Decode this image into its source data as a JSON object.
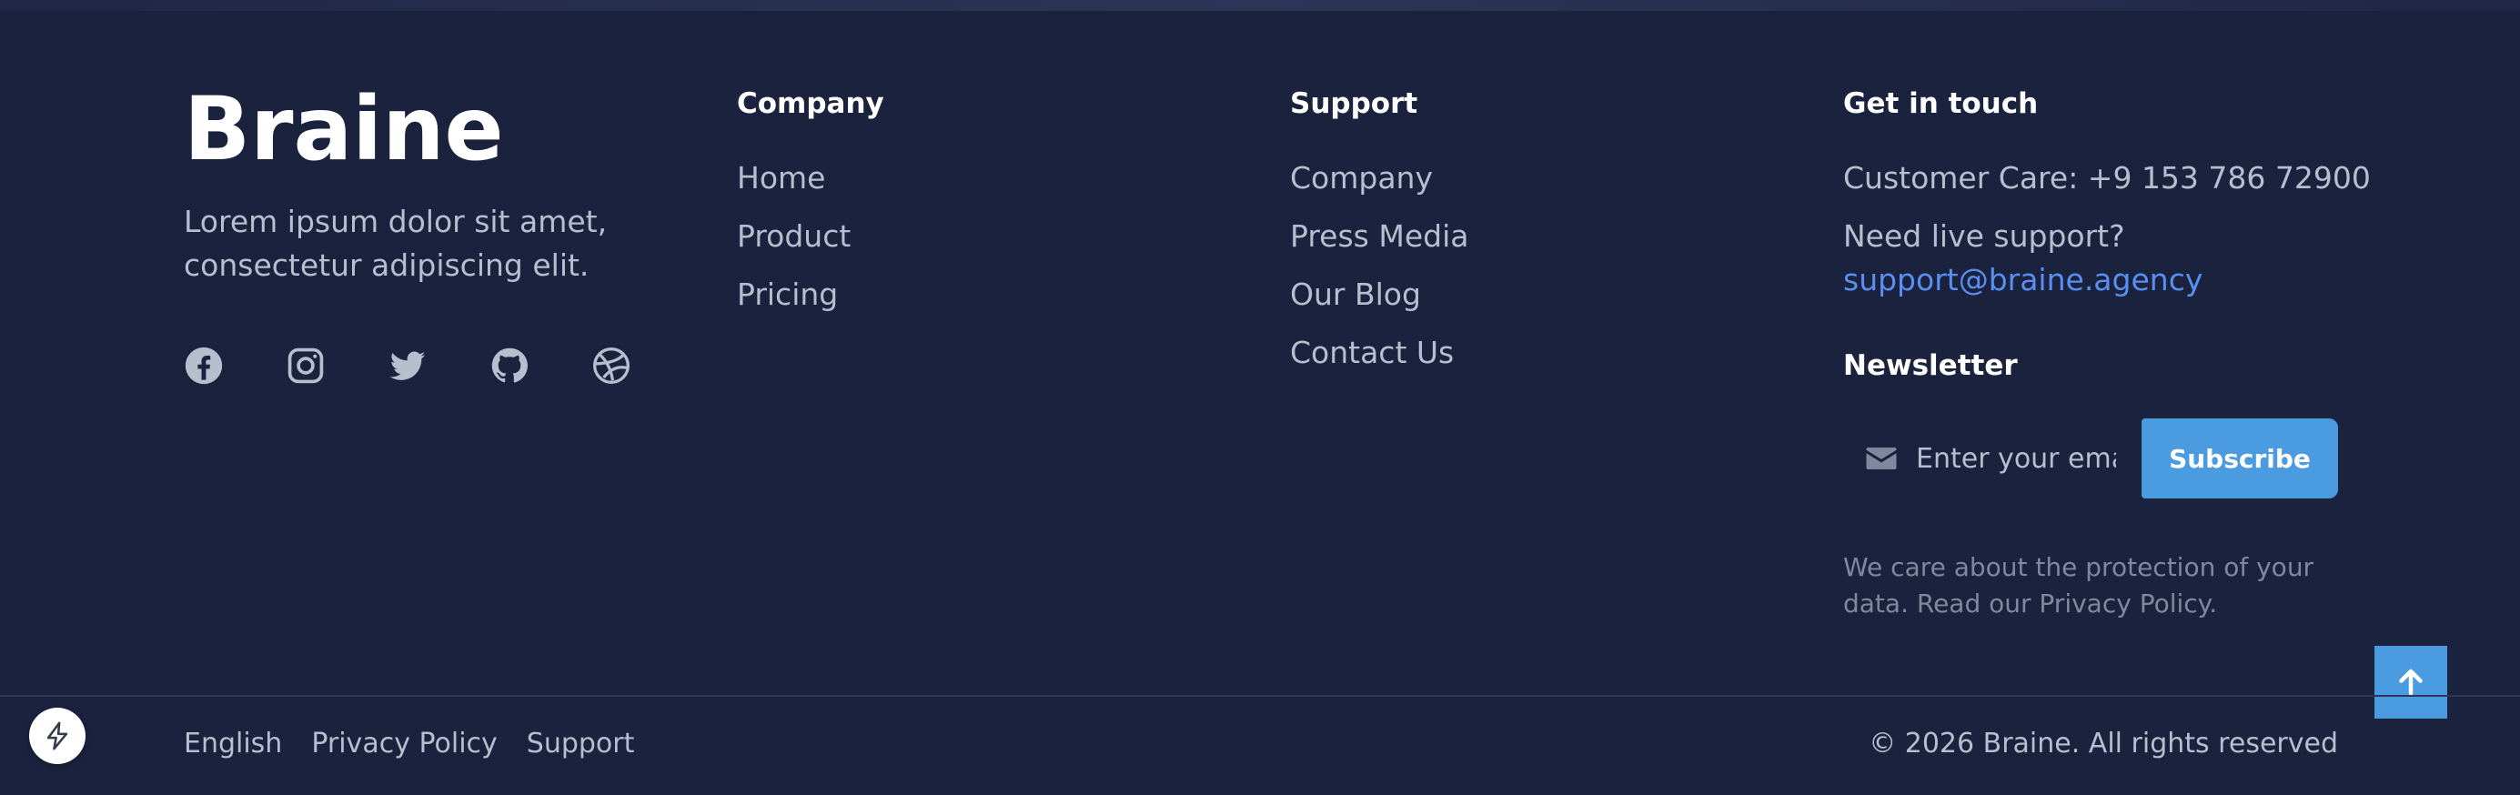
{
  "brand": {
    "name": "Braine",
    "tagline": "Lorem ipsum dolor sit amet, consectetur adipiscing elit."
  },
  "social": [
    "facebook-icon",
    "instagram-icon",
    "twitter-icon",
    "github-icon",
    "dribbble-icon"
  ],
  "company": {
    "heading": "Company",
    "links": [
      "Home",
      "Product",
      "Pricing"
    ]
  },
  "support": {
    "heading": "Support",
    "links": [
      "Company",
      "Press Media",
      "Our Blog",
      "Contact Us"
    ]
  },
  "contact": {
    "heading": "Get in touch",
    "customer_care": "Customer Care: +9 153 786 72900",
    "live_support": "Need live support?",
    "email": "support@braine.agency"
  },
  "newsletter": {
    "heading": "Newsletter",
    "placeholder": "Enter your email",
    "button": "Subscribe",
    "note": "We care about the protection of your data. Read our Privacy Policy."
  },
  "footer": {
    "links": [
      "English",
      "Privacy Policy",
      "Support"
    ],
    "copyright": "© 2026 Braine. All rights reserved"
  },
  "colors": {
    "background": "#1b223d",
    "accent": "#4a9be0",
    "link": "#5a8ff2"
  }
}
